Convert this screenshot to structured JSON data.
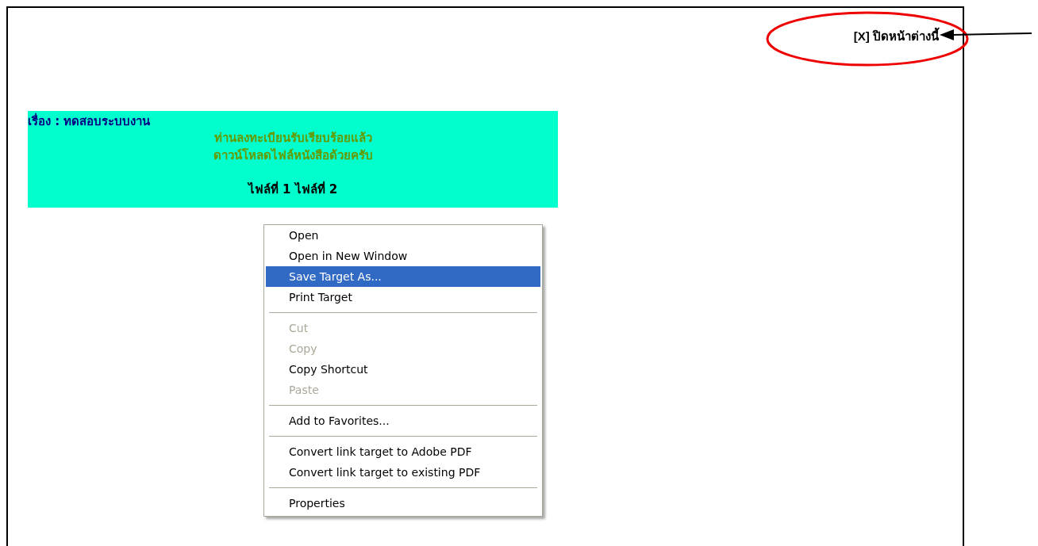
{
  "close_link": {
    "label": "[X] ปิดหน้าต่างนี้"
  },
  "banner": {
    "subject": "เรื่อง : ทดสอบระบบงาน",
    "message_lines": [
      "ท่านลงทะเบียนรับเรียบร้อยแล้ว",
      "ดาวน์โหลดไฟล์หนังสือด้วยครับ"
    ],
    "file_links": [
      "ไฟล์ที่ 1",
      "ไฟล์ที่ 2"
    ]
  },
  "context_menu": {
    "items": [
      {
        "kind": "item",
        "label": "Open",
        "disabled": false,
        "selected": false
      },
      {
        "kind": "item",
        "label": "Open in New Window",
        "disabled": false,
        "selected": false
      },
      {
        "kind": "item",
        "label": "Save Target As...",
        "disabled": false,
        "selected": true
      },
      {
        "kind": "item",
        "label": "Print Target",
        "disabled": false,
        "selected": false
      },
      {
        "kind": "separator"
      },
      {
        "kind": "item",
        "label": "Cut",
        "disabled": true,
        "selected": false
      },
      {
        "kind": "item",
        "label": "Copy",
        "disabled": true,
        "selected": false
      },
      {
        "kind": "item",
        "label": "Copy Shortcut",
        "disabled": false,
        "selected": false
      },
      {
        "kind": "item",
        "label": "Paste",
        "disabled": true,
        "selected": false
      },
      {
        "kind": "separator"
      },
      {
        "kind": "item",
        "label": "Add to Favorites...",
        "disabled": false,
        "selected": false
      },
      {
        "kind": "separator"
      },
      {
        "kind": "item",
        "label": "Convert link target to Adobe PDF",
        "disabled": false,
        "selected": false
      },
      {
        "kind": "item",
        "label": "Convert link target to existing PDF",
        "disabled": false,
        "selected": false
      },
      {
        "kind": "separator"
      },
      {
        "kind": "item",
        "label": "Properties",
        "disabled": false,
        "selected": false
      }
    ]
  }
}
